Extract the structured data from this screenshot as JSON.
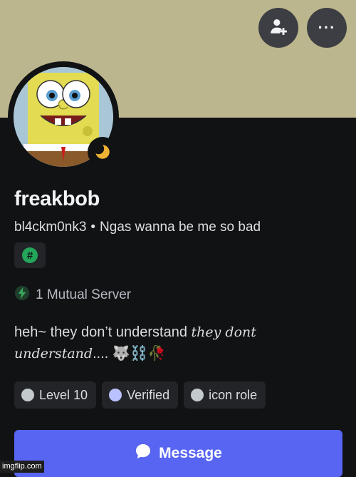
{
  "profile": {
    "display_name": "freakbob",
    "username": "bl4ckm0nk3",
    "separator": "•",
    "custom_status": "Ngas wanna be me so bad",
    "badge_symbol": "#",
    "status": "idle",
    "avatar_image": "spongebob-face"
  },
  "mutual": {
    "label": "1 Mutual Server"
  },
  "bio": {
    "text_plain": "heh~ they don’t understand ",
    "text_italic_1": "they dont",
    "text_italic_2": "understand",
    "ellipsis": "....",
    "emojis": "🐺⛓️🥀"
  },
  "roles": [
    {
      "label": "Level 10",
      "color": "#c4c9ce"
    },
    {
      "label": "Verified",
      "color": "#b9c2ff"
    },
    {
      "label": "icon role",
      "color": "#c4c9ce"
    }
  ],
  "actions": {
    "message_label": "Message",
    "more_label": "···"
  },
  "colors": {
    "banner": "#bcb68e",
    "background": "#111214",
    "accent": "#5865f2",
    "online_badge": "#23a55a",
    "idle_moon": "#f0b232"
  },
  "icons": {
    "add_friend": "add-friend-icon",
    "more": "more-options-icon",
    "mutual": "lightning-bolt-icon",
    "message": "chat-bubble-icon"
  },
  "watermark": "imgflip.com"
}
